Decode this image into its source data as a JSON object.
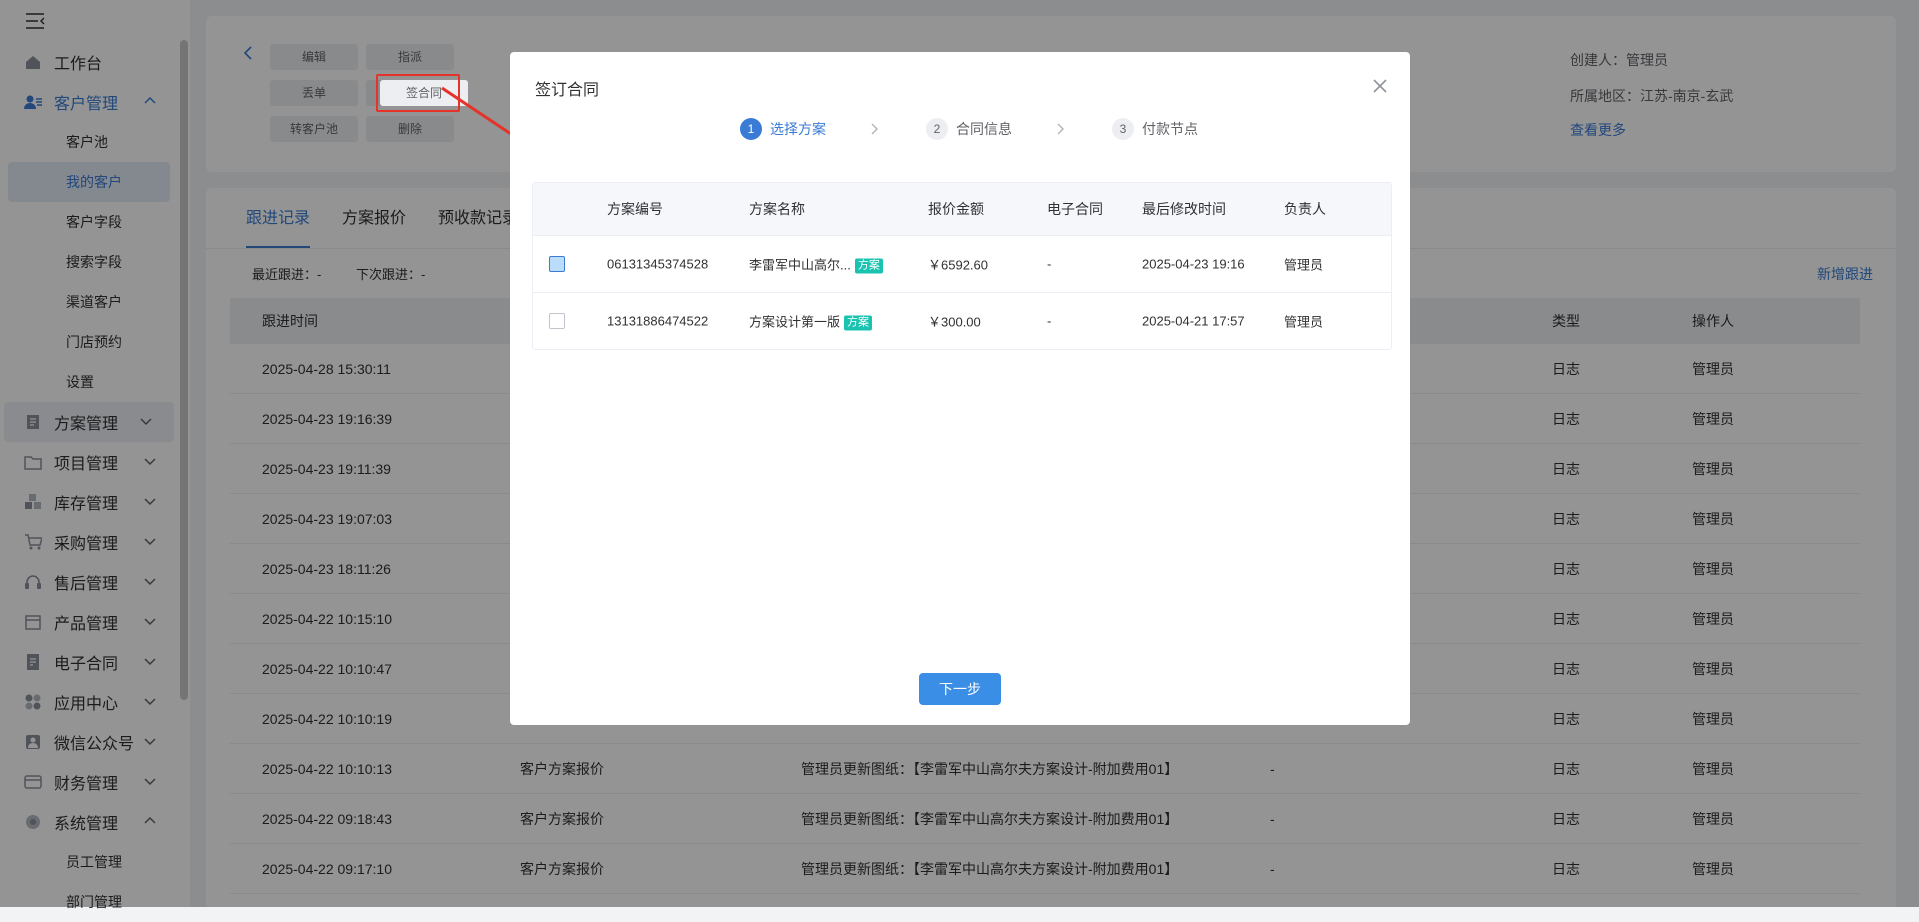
{
  "sidebar": {
    "menu": [
      {
        "label": "工作台",
        "icon": "home-icon"
      },
      {
        "label": "客户管理",
        "icon": "customer-icon",
        "expanded": true
      },
      {
        "label": "方案管理",
        "icon": "plan-icon"
      },
      {
        "label": "项目管理",
        "icon": "folder-icon"
      },
      {
        "label": "库存管理",
        "icon": "inventory-icon"
      },
      {
        "label": "采购管理",
        "icon": "cart-icon"
      },
      {
        "label": "售后管理",
        "icon": "headset-icon"
      },
      {
        "label": "产品管理",
        "icon": "product-icon"
      },
      {
        "label": "电子合同",
        "icon": "contract-icon"
      },
      {
        "label": "应用中心",
        "icon": "apps-icon"
      },
      {
        "label": "微信公众号",
        "icon": "wechat-icon"
      },
      {
        "label": "财务管理",
        "icon": "finance-icon"
      },
      {
        "label": "系统管理",
        "icon": "system-icon",
        "expanded": true
      }
    ],
    "customer_sub": [
      "客户池",
      "我的客户",
      "客户字段",
      "搜索字段",
      "渠道客户",
      "门店预约",
      "设置"
    ],
    "system_sub": [
      "员工管理",
      "部门管理"
    ]
  },
  "header": {
    "buttons": [
      "编辑",
      "指派",
      "丢单",
      "签合同",
      "转客户池",
      "删除"
    ],
    "creator": "创建人：管理员",
    "region": "所属地区：江苏-南京-玄武",
    "more_link": "查看更多"
  },
  "tabs": [
    "跟进记录",
    "方案报价",
    "预收款记录"
  ],
  "follow_info": {
    "recent": "最近跟进：-",
    "next": "下次跟进：-",
    "new_button": "新增跟进"
  },
  "records_table": {
    "headers": [
      "跟进时间",
      "类型",
      "操作人"
    ],
    "rows": [
      {
        "time": "2025-04-28 15:30:11",
        "source": "",
        "content": "",
        "dash": "",
        "type": "日志",
        "operator": "管理员"
      },
      {
        "time": "2025-04-23 19:16:39",
        "source": "",
        "content": "",
        "dash": "",
        "type": "日志",
        "operator": "管理员"
      },
      {
        "time": "2025-04-23 19:11:39",
        "source": "",
        "content": "",
        "dash": "",
        "type": "日志",
        "operator": "管理员"
      },
      {
        "time": "2025-04-23 19:07:03",
        "source": "",
        "content": "",
        "dash": "",
        "type": "日志",
        "operator": "管理员"
      },
      {
        "time": "2025-04-23 18:11:26",
        "source": "",
        "content": "",
        "dash": "",
        "type": "日志",
        "operator": "管理员"
      },
      {
        "time": "2025-04-22 10:15:10",
        "source": "",
        "content": "",
        "dash": "",
        "type": "日志",
        "operator": "管理员"
      },
      {
        "time": "2025-04-22 10:10:47",
        "source": "",
        "content": "",
        "dash": "",
        "type": "日志",
        "operator": "管理员"
      },
      {
        "time": "2025-04-22 10:10:19",
        "source": "",
        "content": "",
        "dash": "",
        "type": "日志",
        "operator": "管理员"
      },
      {
        "time": "2025-04-22 10:10:13",
        "source": "客户方案报价",
        "content": "管理员更新图纸：【李雷军中山高尔夫方案设计-附加费用01】",
        "dash": "-",
        "type": "日志",
        "operator": "管理员"
      },
      {
        "time": "2025-04-22 09:18:43",
        "source": "客户方案报价",
        "content": "管理员更新图纸：【李雷军中山高尔夫方案设计-附加费用01】",
        "dash": "-",
        "type": "日志",
        "operator": "管理员"
      },
      {
        "time": "2025-04-22 09:17:10",
        "source": "客户方案报价",
        "content": "管理员更新图纸：【李雷军中山高尔夫方案设计-附加费用01】",
        "dash": "-",
        "type": "日志",
        "operator": "管理员"
      }
    ]
  },
  "modal": {
    "title": "签订合同",
    "steps": [
      {
        "num": "1",
        "label": "选择方案"
      },
      {
        "num": "2",
        "label": "合同信息"
      },
      {
        "num": "3",
        "label": "付款节点"
      }
    ],
    "table": {
      "headers": [
        "方案编号",
        "方案名称",
        "报价金额",
        "电子合同",
        "最后修改时间",
        "负责人"
      ],
      "rows": [
        {
          "id": "06131345374528",
          "name": "李雷军中山高尔...",
          "tag": "方案",
          "amount": "￥6592.60",
          "contract": "-",
          "modified": "2025-04-23 19:16",
          "owner": "管理员",
          "checked": true
        },
        {
          "id": "13131886474522",
          "name": "方案设计第一版",
          "tag": "方案",
          "amount": "￥300.00",
          "contract": "-",
          "modified": "2025-04-21 17:57",
          "owner": "管理员",
          "checked": false
        }
      ]
    },
    "next_button": "下一步"
  },
  "colors": {
    "primary": "#3a7bd5",
    "tag": "#19c3b0",
    "highlight": "#e5332a"
  }
}
